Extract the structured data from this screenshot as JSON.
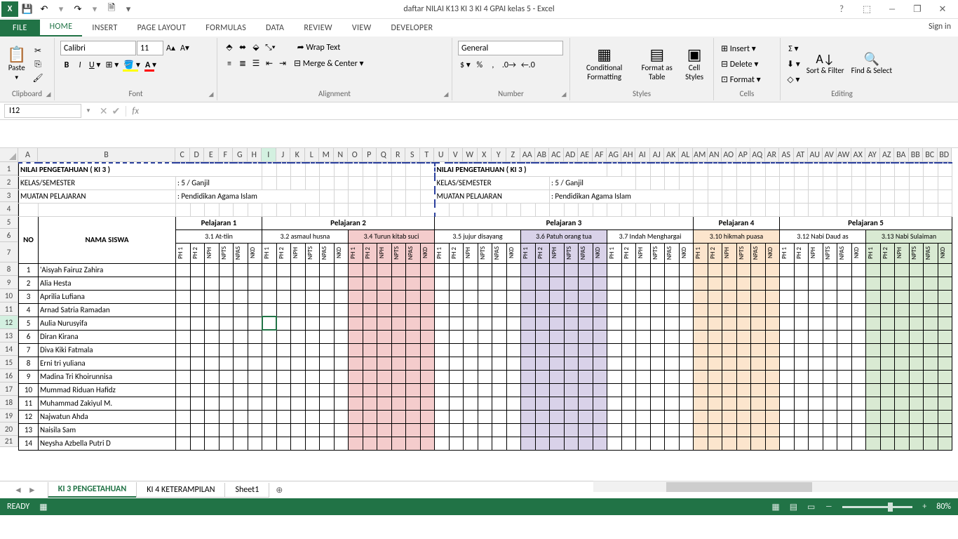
{
  "app": {
    "title": "daftar NILAI K13 KI 3 KI 4 GPAI kelas 5 - Excel",
    "signin": "Sign in"
  },
  "qat": {
    "save": "💾",
    "undo": "↶",
    "redo": "↷",
    "new": "🗎"
  },
  "tabs": [
    "FILE",
    "HOME",
    "INSERT",
    "PAGE LAYOUT",
    "FORMULAS",
    "DATA",
    "REVIEW",
    "VIEW",
    "DEVELOPER"
  ],
  "ribbon": {
    "clipboard": {
      "label": "Clipboard",
      "paste": "Paste"
    },
    "font": {
      "label": "Font",
      "family": "Calibri",
      "size": "11"
    },
    "alignment": {
      "label": "Alignment",
      "wrap": "Wrap Text",
      "merge": "Merge & Center"
    },
    "number": {
      "label": "Number",
      "format": "General"
    },
    "styles": {
      "label": "Styles",
      "cond": "Conditional Formatting",
      "table": "Format as Table",
      "cell": "Cell Styles"
    },
    "cells": {
      "label": "Cells",
      "insert": "Insert",
      "delete": "Delete",
      "format": "Format"
    },
    "editing": {
      "label": "Editing",
      "sort": "Sort & Filter",
      "find": "Find & Select"
    }
  },
  "namebox": "I12",
  "sheet": {
    "title": "NILAI PENGETAHUAN ( KI 3 )",
    "kelas_lbl": "KELAS/SEMESTER",
    "kelas_val": ": 5 / Ganjil",
    "muatan_lbl": "MUATAN PELAJARAN",
    "muatan_val": ": Pendidikan Agama Islam",
    "no": "NO",
    "nama": "NAMA SISWA",
    "pelajaran": [
      "Pelajaran 1",
      "Pelajaran 2",
      "Pelajaran 3",
      "Pelajaran 4",
      "Pelajaran 5"
    ],
    "sub": [
      "3.1   At-tiin",
      "3.2 asmaul husna",
      "3.4   Turun kitab suci",
      "3.5 jujur disayang",
      "3.6   Patuh orang tua",
      "3.7   Indah Menghargai",
      "3.10 hikmah puasa",
      "3.12   Nabi Daud as",
      "3.13   Nabi Sulaiman"
    ],
    "cols": [
      "PH 1",
      "PH 2",
      "NPH",
      "NPTS",
      "NPAS",
      "NKD"
    ],
    "students": [
      "'Aisyah Fairuz Zahira",
      "Alia Hesta",
      "Aprilia Lufiana",
      "Arnad Satria Ramadan",
      "Aulia Nurusyifa",
      "Diran Kirana",
      "Diva Kiki Fatmala",
      "Erni tri yuliana",
      "Madina Tri Khoirunnisa",
      "Mummad Riduan Hafidz",
      "Muhammad Zakiyul M.",
      "Najwatun Ahda",
      "Naisila Sam",
      "Neysha Azbella Putri D"
    ]
  },
  "col_letters": [
    "A",
    "B",
    "C",
    "D",
    "E",
    "F",
    "G",
    "H",
    "I",
    "J",
    "K",
    "L",
    "M",
    "N",
    "O",
    "P",
    "Q",
    "R",
    "S",
    "T",
    "U",
    "V",
    "W",
    "X",
    "Y",
    "Z",
    "AA",
    "AB",
    "AC",
    "AD",
    "AE",
    "AF",
    "AG",
    "AH",
    "AI",
    "AJ",
    "AK",
    "AL",
    "AM",
    "AN",
    "AO",
    "AP",
    "AQ",
    "AR",
    "AS",
    "AT",
    "AU",
    "AV",
    "AW",
    "AX",
    "AY",
    "AZ",
    "BA",
    "BB",
    "BC",
    "BD"
  ],
  "sheets": {
    "tabs": [
      "KI 3 PENGETAHUAN",
      "KI 4 KETERAMPILAN",
      "Sheet1"
    ],
    "active": 0
  },
  "status": {
    "ready": "READY",
    "zoom": "80%"
  }
}
